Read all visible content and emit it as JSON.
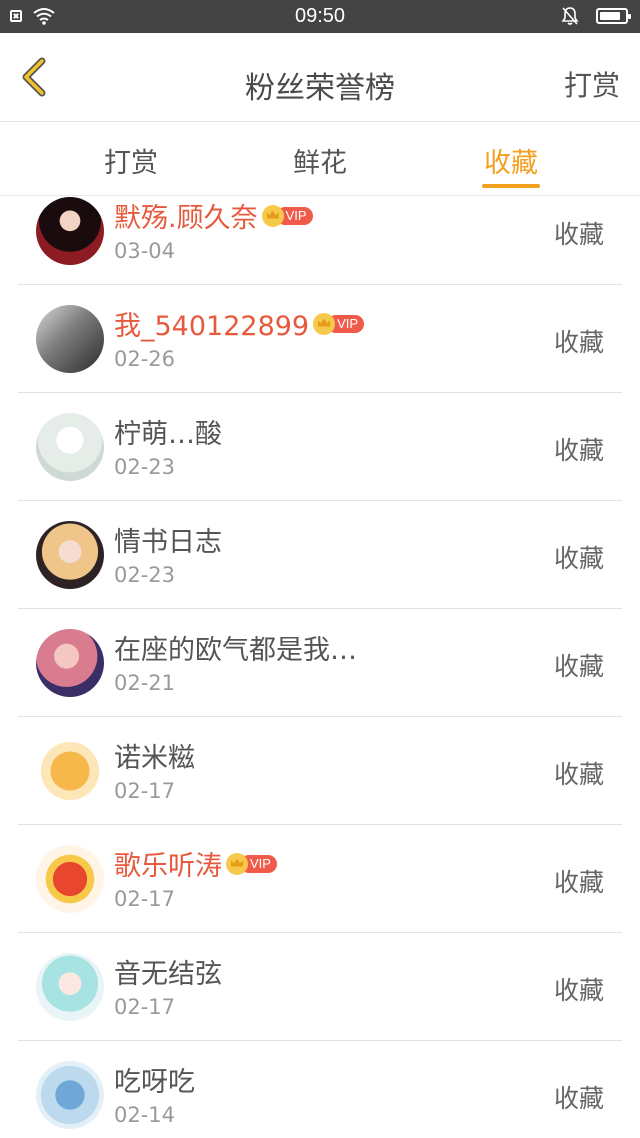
{
  "status_bar": {
    "time": "09:50",
    "battery_level": 0.85
  },
  "header": {
    "title": "粉丝荣誉榜",
    "right_action": "打赏"
  },
  "tabs": [
    {
      "label": "打赏",
      "active": false
    },
    {
      "label": "鲜花",
      "active": false
    },
    {
      "label": "收藏",
      "active": true
    }
  ],
  "vip_badge_text": "VIP",
  "fans": [
    {
      "name": "默殇.顾久奈",
      "date": "03-04",
      "vip": true,
      "action": "收藏"
    },
    {
      "name": "我_540122899",
      "date": "02-26",
      "vip": true,
      "action": "收藏"
    },
    {
      "name": "柠萌…酸",
      "date": "02-23",
      "vip": false,
      "action": "收藏"
    },
    {
      "name": "情书日志",
      "date": "02-23",
      "vip": false,
      "action": "收藏"
    },
    {
      "name": "在座的欧气都是我…",
      "date": "02-21",
      "vip": false,
      "action": "收藏"
    },
    {
      "name": "诺米糍",
      "date": "02-17",
      "vip": false,
      "action": "收藏"
    },
    {
      "name": "歌乐听涛",
      "date": "02-17",
      "vip": true,
      "action": "收藏"
    },
    {
      "name": "音无结弦",
      "date": "02-17",
      "vip": false,
      "action": "收藏"
    },
    {
      "name": "吃呀吃",
      "date": "02-14",
      "vip": false,
      "action": "收藏"
    }
  ],
  "colors": {
    "accent": "#f3a01f",
    "vip_name": "#e7593c",
    "status_bar": "#444444"
  }
}
